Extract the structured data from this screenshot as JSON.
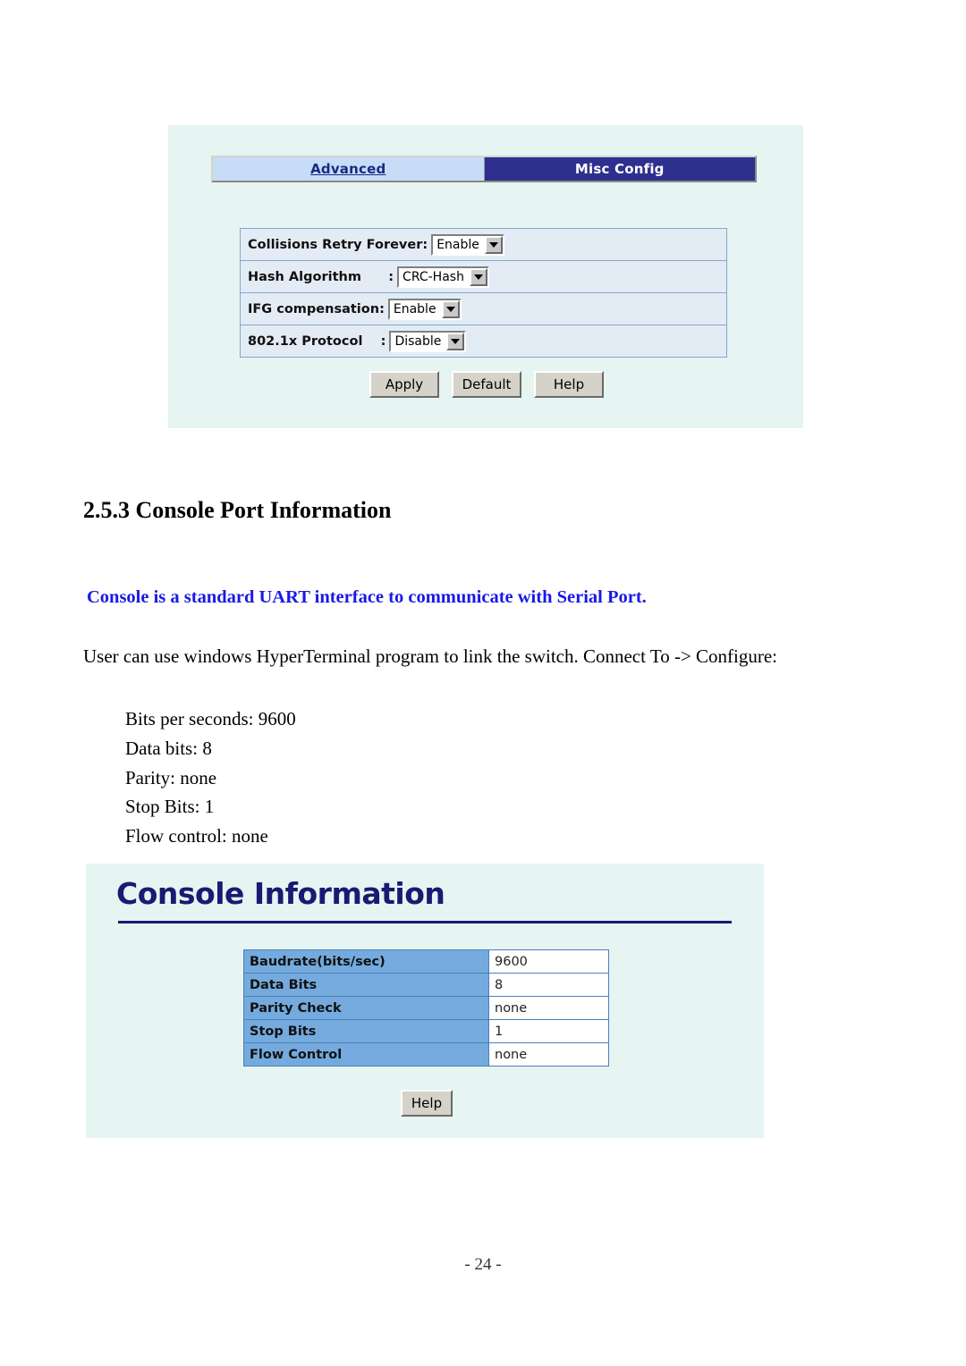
{
  "misc_config_screenshot": {
    "tabs": [
      {
        "label": "Advanced",
        "active": false
      },
      {
        "label": "Misc Config",
        "active": true
      }
    ],
    "form_rows": [
      {
        "label": "Collisions Retry Forever",
        "colon": ":",
        "value": "Enable"
      },
      {
        "label": "Hash Algorithm      ",
        "colon": ":",
        "value": "CRC-Hash"
      },
      {
        "label": "IFG compensation",
        "colon": ":",
        "value": "Enable"
      },
      {
        "label": "802.1x Protocol    ",
        "colon": ":",
        "value": "Disable"
      }
    ],
    "buttons": [
      {
        "label": "Apply"
      },
      {
        "label": "Default"
      },
      {
        "label": "Help"
      }
    ]
  },
  "document": {
    "section_heading": "2.5.3 Console Port Information",
    "highlight_note": "Console is a standard UART interface to communicate with Serial Port.",
    "paragraph": "User can use windows HyperTerminal program to link the switch. Connect To -> Configure:",
    "settings_list": [
      "Bits per seconds: 9600",
      "Data bits: 8",
      "Parity: none",
      "Stop Bits: 1",
      "Flow control: none"
    ],
    "page_number": "- 24 -"
  },
  "console_info_screenshot": {
    "heading": "Console Information",
    "table_rows": [
      {
        "key": "Baudrate(bits/sec)",
        "value": "9600"
      },
      {
        "key": "Data Bits",
        "value": "8"
      },
      {
        "key": "Parity Check",
        "value": "none"
      },
      {
        "key": "Stop Bits",
        "value": "1"
      },
      {
        "key": "Flow Control",
        "value": "none"
      }
    ],
    "buttons": [
      {
        "label": "Help"
      }
    ]
  },
  "colors": {
    "panel_background": "#e6f4f2",
    "tab_active_background": "#2e2f8f",
    "tab_inactive_background": "#c7ddf7",
    "table_key_background": "#74aadd",
    "heading_navy": "#1a1a72",
    "note_blue": "#1919e6"
  }
}
